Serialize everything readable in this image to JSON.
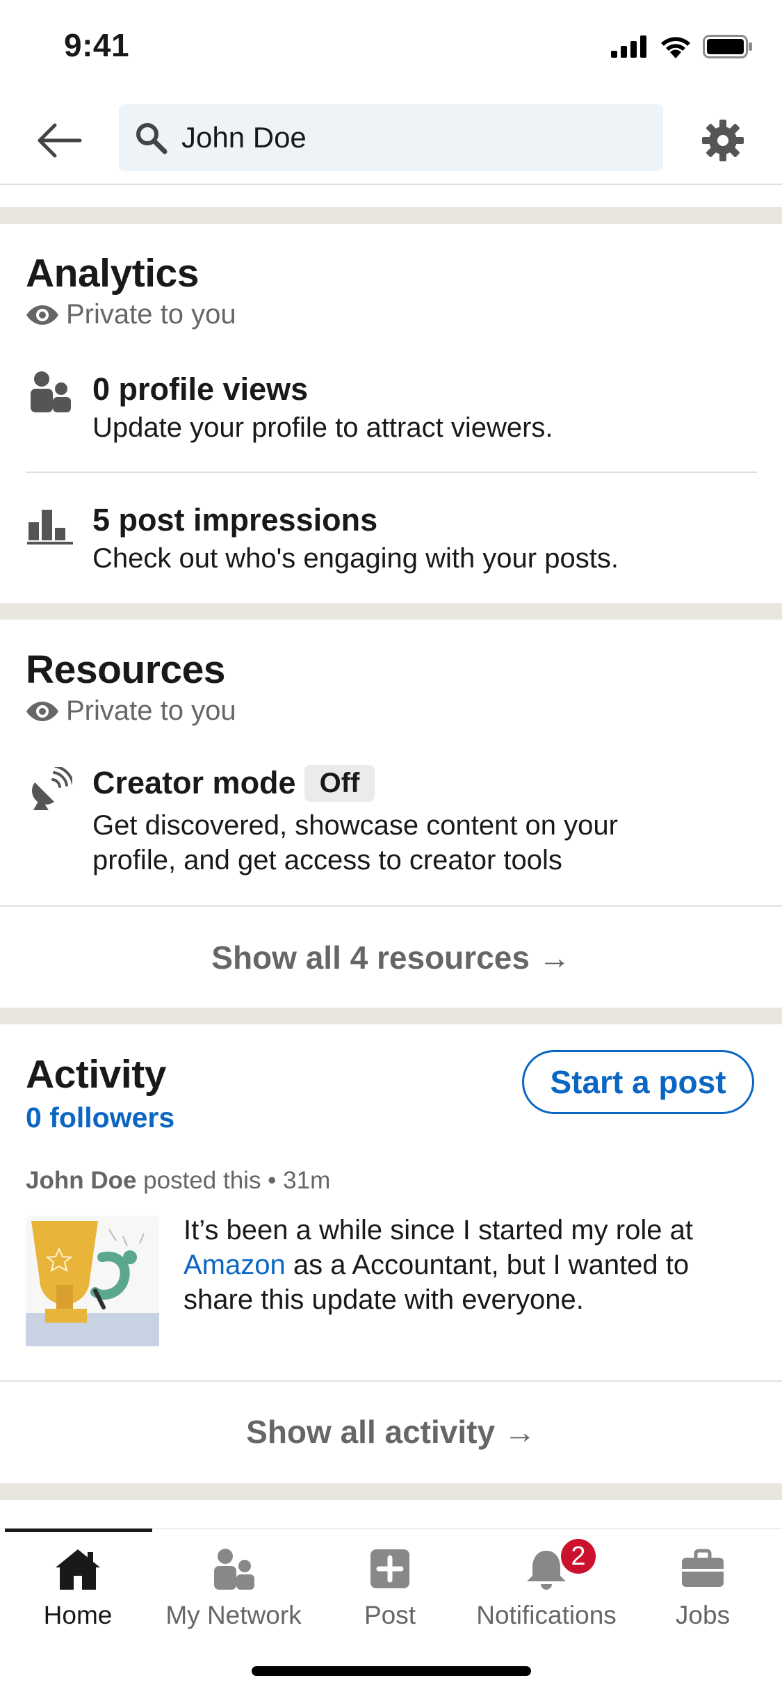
{
  "status_bar": {
    "time": "9:41"
  },
  "search": {
    "query": "John Doe"
  },
  "analytics": {
    "title": "Analytics",
    "private_label": "Private to you",
    "profile_views": {
      "title": "0 profile views",
      "subtitle": "Update your profile to attract viewers."
    },
    "post_impressions": {
      "title": "5 post impressions",
      "subtitle": "Check out who's engaging with your posts."
    }
  },
  "resources": {
    "title": "Resources",
    "private_label": "Private to you",
    "creator_mode": {
      "title": "Creator mode",
      "status": "Off",
      "subtitle_line1": "Get discovered, showcase content on your",
      "subtitle_line2": "profile, and get access to creator tools"
    },
    "show_all": "Show all 4 resources →"
  },
  "activity": {
    "title": "Activity",
    "followers": "0 followers",
    "start_post": "Start a post",
    "post": {
      "author": "John Doe",
      "meta": " posted this • 31m",
      "text_line1": "It’s been a while since I started my role at",
      "company": "Amazon",
      "text_line2_rest": " as a Accountant, but I wanted to",
      "text_line3": "share this update with everyone."
    },
    "show_all": "Show all activity →"
  },
  "bottom_nav": {
    "items": [
      {
        "label": "Home",
        "icon": "home-icon",
        "active": true
      },
      {
        "label": "My Network",
        "icon": "network-icon"
      },
      {
        "label": "Post",
        "icon": "plus-square-icon"
      },
      {
        "label": "Notifications",
        "icon": "bell-icon",
        "badge": "2"
      },
      {
        "label": "Jobs",
        "icon": "briefcase-icon"
      }
    ]
  },
  "colors": {
    "accent": "#0a66c2",
    "badge_red": "#cb112d",
    "section_gap": "#e9e5df"
  }
}
